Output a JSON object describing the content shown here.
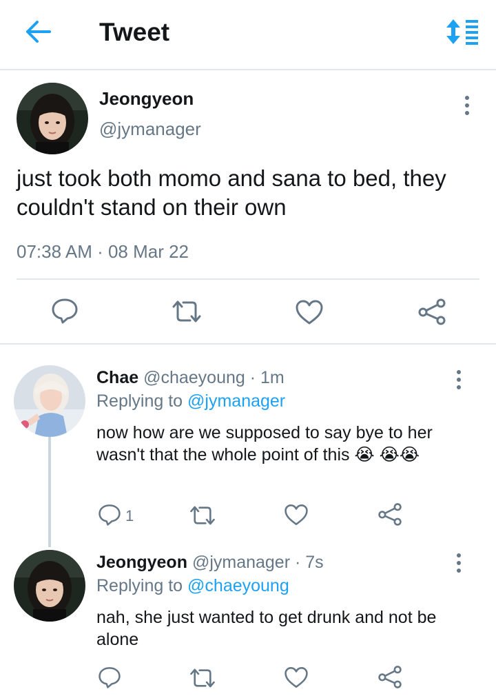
{
  "header": {
    "title": "Tweet"
  },
  "main_tweet": {
    "name": "Jeongyeon",
    "handle": "@jymanager",
    "text": "just took both momo and sana to bed, they couldn't stand on their own",
    "timestamp": "07:38 AM · 08 Mar 22"
  },
  "replies": [
    {
      "name": "Chae",
      "meta": "@chaeyoung · 1m",
      "replying_prefix": "Replying to",
      "replying_to": "@jymanager",
      "text": "now how are we supposed to say bye to her wasn't that the whole point of this",
      "emoji": [
        "😭",
        "😭",
        "😭"
      ],
      "reply_count": "1"
    },
    {
      "name": "Jeongyeon",
      "meta": "@jymanager · 7s",
      "replying_prefix": "Replying to",
      "replying_to": "@chaeyoung",
      "text": "nah, she just wanted to get drunk and not be alone"
    }
  ],
  "colors": {
    "accent": "#1da1f2",
    "secondary_text": "#657786",
    "divider": "#e1e8ed"
  }
}
